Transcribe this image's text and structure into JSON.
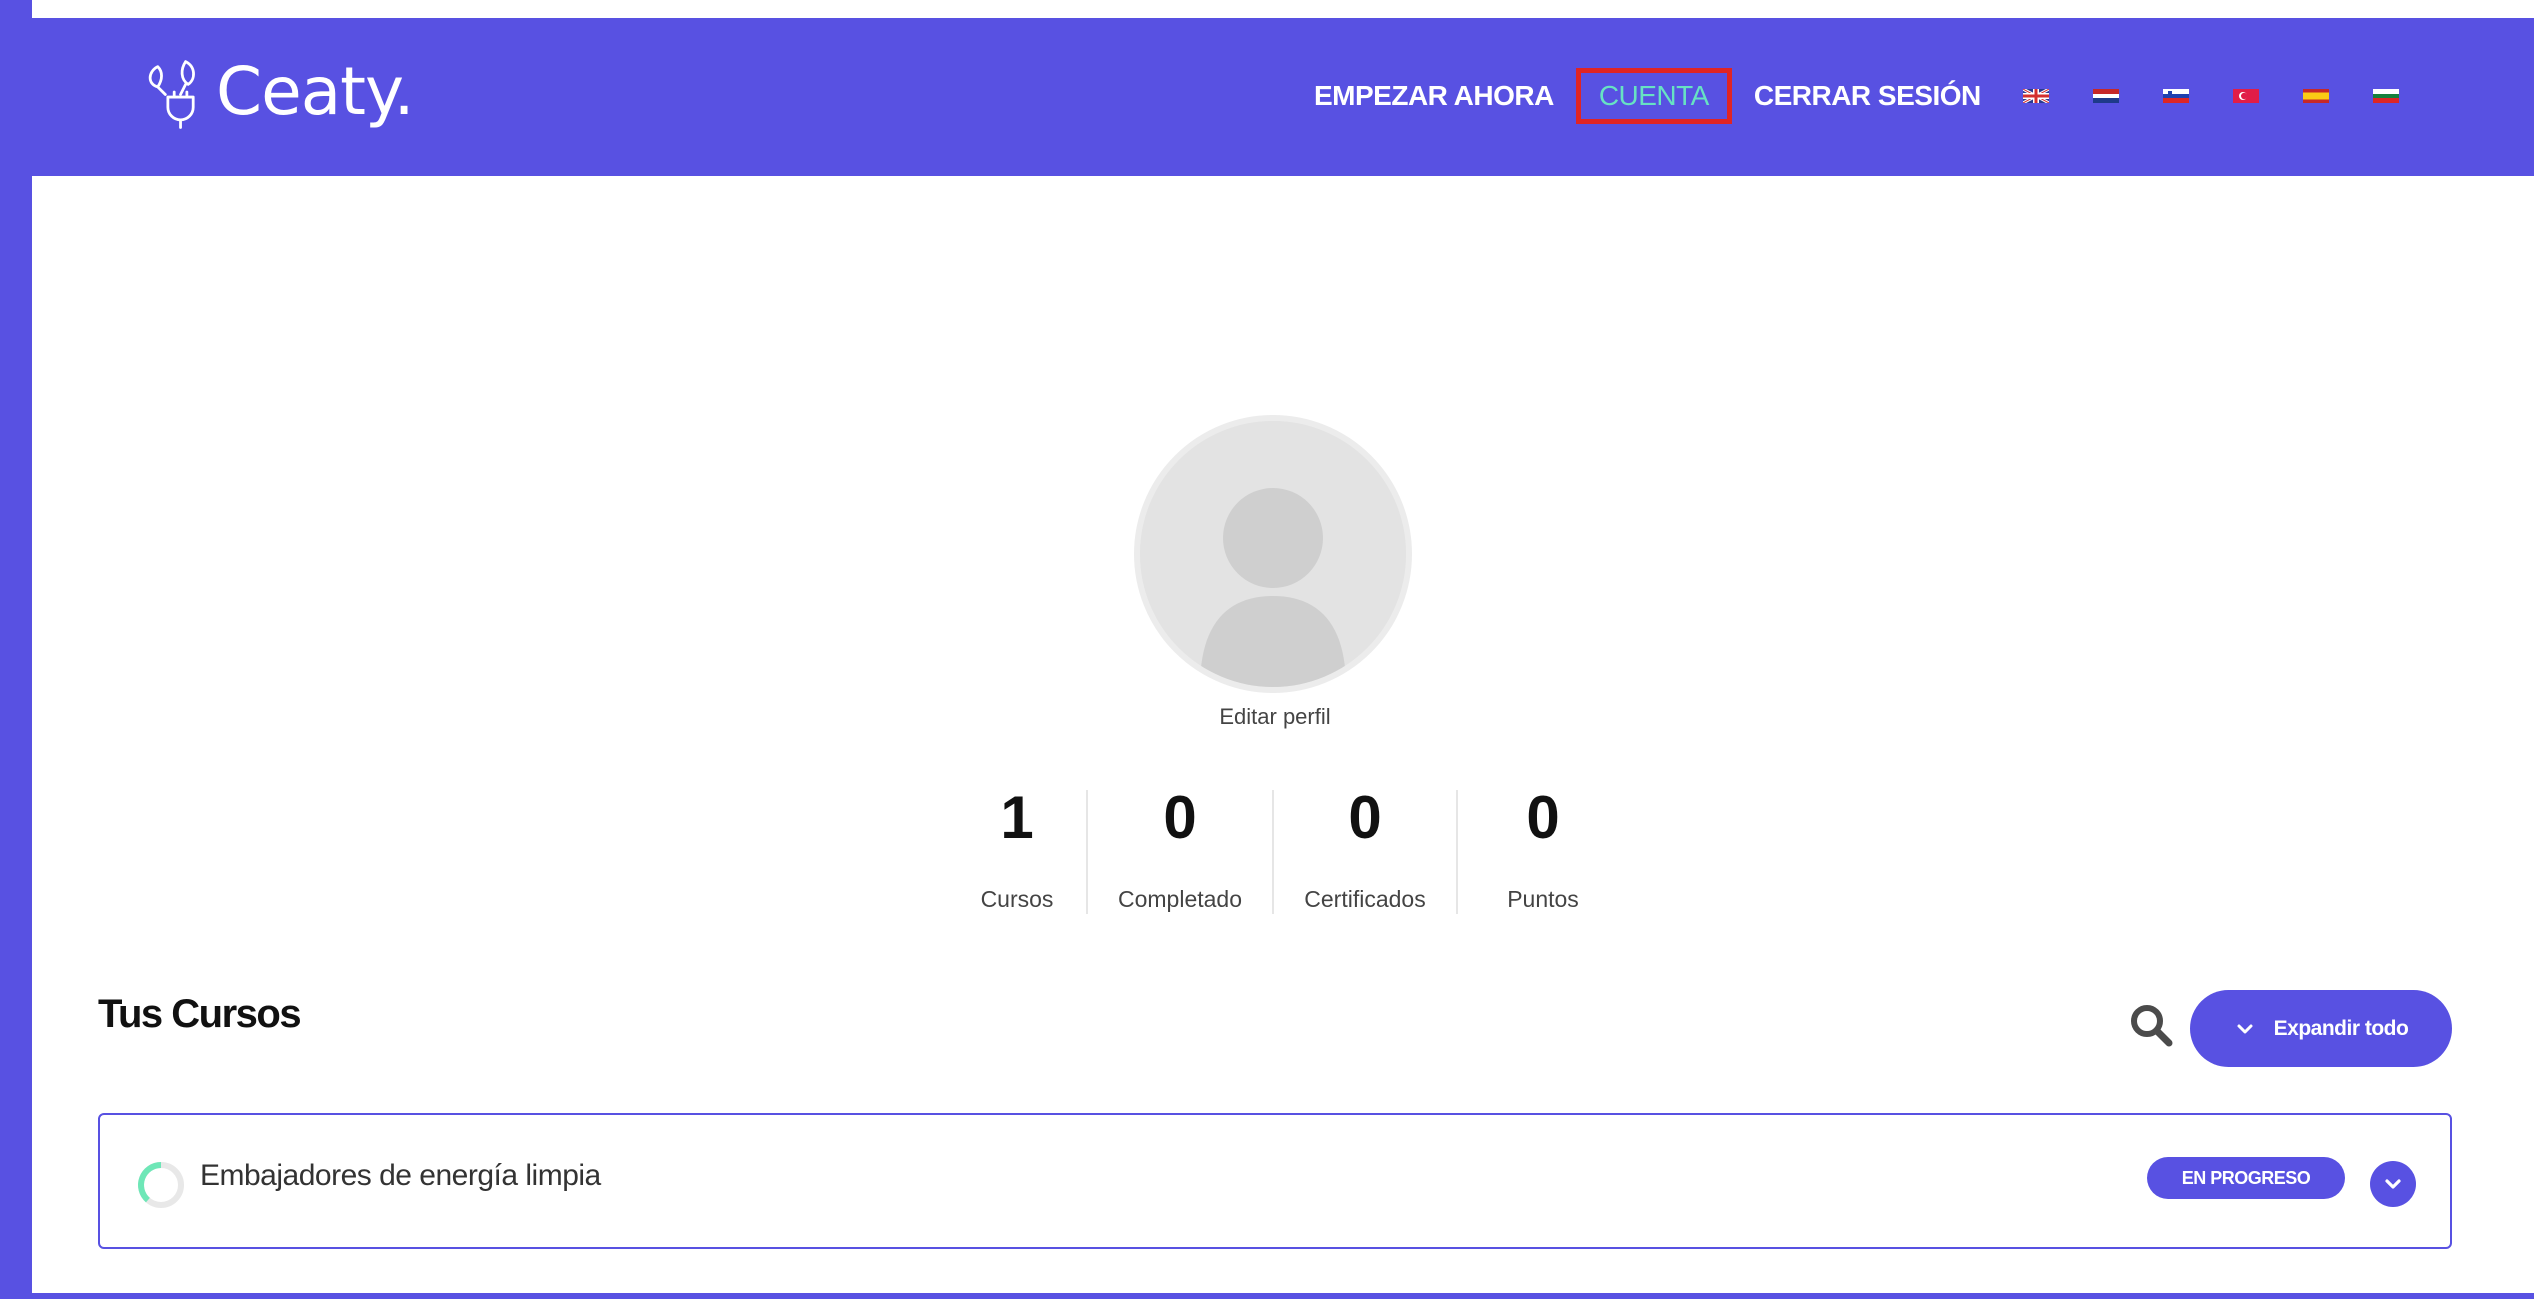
{
  "brand": {
    "name": "Ceaty."
  },
  "nav": {
    "links": [
      {
        "label": "EMPEZAR AHORA",
        "active": false
      },
      {
        "label": "CUENTA",
        "active": true
      },
      {
        "label": "CERRAR SESIÓN",
        "active": false
      }
    ],
    "languages": [
      "uk-flag-icon",
      "nl-flag-icon",
      "si-flag-icon",
      "tr-flag-icon",
      "es-flag-icon",
      "bg-flag-icon"
    ]
  },
  "profile": {
    "edit_label": "Editar perfil",
    "stats": [
      {
        "value": "1",
        "label": "Cursos"
      },
      {
        "value": "0",
        "label": "Completado"
      },
      {
        "value": "0",
        "label": "Certificados"
      },
      {
        "value": "0",
        "label": "Puntos"
      }
    ]
  },
  "courses_section": {
    "title": "Tus Cursos",
    "expand_all_label": "Expandir todo",
    "courses": [
      {
        "title": "Embajadores de energía limpia",
        "status": "EN PROGRESO"
      }
    ]
  },
  "colors": {
    "primary": "#5851e2",
    "active_nav_text": "#67e2c3",
    "active_nav_border": "#e02424",
    "progress_ring": "#6ee7b7"
  }
}
